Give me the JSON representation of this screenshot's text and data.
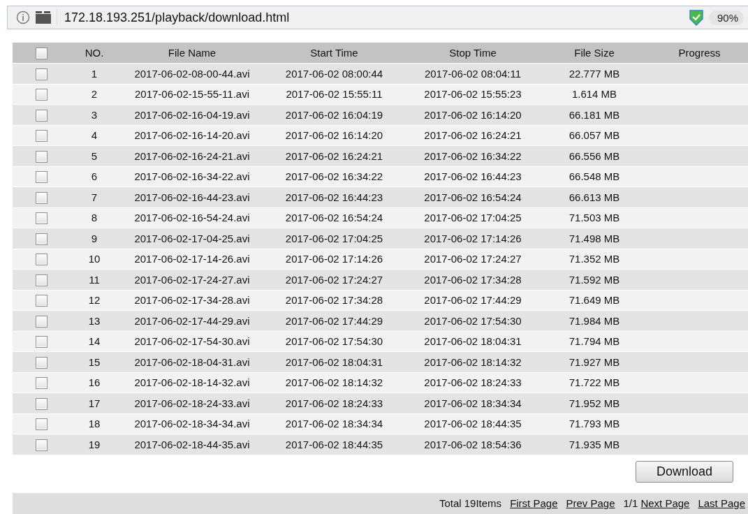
{
  "address_bar": {
    "url": "172.18.193.251/playback/download.html",
    "zoom": "90%"
  },
  "table": {
    "select_all": {
      "checked": false
    },
    "columns": [
      "NO.",
      "File Name",
      "Start Time",
      "Stop Time",
      "File Size",
      "Progress"
    ],
    "rows": [
      {
        "checked": false,
        "no": "1",
        "file_name": "2017-06-02-08-00-44.avi",
        "start": "2017-06-02 08:00:44",
        "stop": "2017-06-02 08:04:11",
        "size": "22.777 MB"
      },
      {
        "checked": false,
        "no": "2",
        "file_name": "2017-06-02-15-55-11.avi",
        "start": "2017-06-02 15:55:11",
        "stop": "2017-06-02 15:55:23",
        "size": "1.614 MB"
      },
      {
        "checked": false,
        "no": "3",
        "file_name": "2017-06-02-16-04-19.avi",
        "start": "2017-06-02 16:04:19",
        "stop": "2017-06-02 16:14:20",
        "size": "66.181 MB"
      },
      {
        "checked": false,
        "no": "4",
        "file_name": "2017-06-02-16-14-20.avi",
        "start": "2017-06-02 16:14:20",
        "stop": "2017-06-02 16:24:21",
        "size": "66.057 MB"
      },
      {
        "checked": false,
        "no": "5",
        "file_name": "2017-06-02-16-24-21.avi",
        "start": "2017-06-02 16:24:21",
        "stop": "2017-06-02 16:34:22",
        "size": "66.556 MB"
      },
      {
        "checked": false,
        "no": "6",
        "file_name": "2017-06-02-16-34-22.avi",
        "start": "2017-06-02 16:34:22",
        "stop": "2017-06-02 16:44:23",
        "size": "66.548 MB"
      },
      {
        "checked": false,
        "no": "7",
        "file_name": "2017-06-02-16-44-23.avi",
        "start": "2017-06-02 16:44:23",
        "stop": "2017-06-02 16:54:24",
        "size": "66.613 MB"
      },
      {
        "checked": false,
        "no": "8",
        "file_name": "2017-06-02-16-54-24.avi",
        "start": "2017-06-02 16:54:24",
        "stop": "2017-06-02 17:04:25",
        "size": "71.503 MB"
      },
      {
        "checked": false,
        "no": "9",
        "file_name": "2017-06-02-17-04-25.avi",
        "start": "2017-06-02 17:04:25",
        "stop": "2017-06-02 17:14:26",
        "size": "71.498 MB"
      },
      {
        "checked": false,
        "no": "10",
        "file_name": "2017-06-02-17-14-26.avi",
        "start": "2017-06-02 17:14:26",
        "stop": "2017-06-02 17:24:27",
        "size": "71.352 MB"
      },
      {
        "checked": false,
        "no": "11",
        "file_name": "2017-06-02-17-24-27.avi",
        "start": "2017-06-02 17:24:27",
        "stop": "2017-06-02 17:34:28",
        "size": "71.592 MB"
      },
      {
        "checked": false,
        "no": "12",
        "file_name": "2017-06-02-17-34-28.avi",
        "start": "2017-06-02 17:34:28",
        "stop": "2017-06-02 17:44:29",
        "size": "71.649 MB"
      },
      {
        "checked": false,
        "no": "13",
        "file_name": "2017-06-02-17-44-29.avi",
        "start": "2017-06-02 17:44:29",
        "stop": "2017-06-02 17:54:30",
        "size": "71.984 MB"
      },
      {
        "checked": false,
        "no": "14",
        "file_name": "2017-06-02-17-54-30.avi",
        "start": "2017-06-02 17:54:30",
        "stop": "2017-06-02 18:04:31",
        "size": "71.794 MB"
      },
      {
        "checked": false,
        "no": "15",
        "file_name": "2017-06-02-18-04-31.avi",
        "start": "2017-06-02 18:04:31",
        "stop": "2017-06-02 18:14:32",
        "size": "71.927 MB"
      },
      {
        "checked": false,
        "no": "16",
        "file_name": "2017-06-02-18-14-32.avi",
        "start": "2017-06-02 18:14:32",
        "stop": "2017-06-02 18:24:33",
        "size": "71.722 MB"
      },
      {
        "checked": false,
        "no": "17",
        "file_name": "2017-06-02-18-24-33.avi",
        "start": "2017-06-02 18:24:33",
        "stop": "2017-06-02 18:34:34",
        "size": "71.952 MB"
      },
      {
        "checked": false,
        "no": "18",
        "file_name": "2017-06-02-18-34-34.avi",
        "start": "2017-06-02 18:34:34",
        "stop": "2017-06-02 18:44:35",
        "size": "71.793 MB"
      },
      {
        "checked": false,
        "no": "19",
        "file_name": "2017-06-02-18-44-35.avi",
        "start": "2017-06-02 18:44:35",
        "stop": "2017-06-02 18:54:36",
        "size": "71.935 MB"
      }
    ]
  },
  "download_button": "Download",
  "pager": {
    "total": "Total 19Items",
    "first": "First Page",
    "prev": "Prev Page",
    "page": "1/1",
    "next": "Next Page",
    "last": "Last Page"
  }
}
